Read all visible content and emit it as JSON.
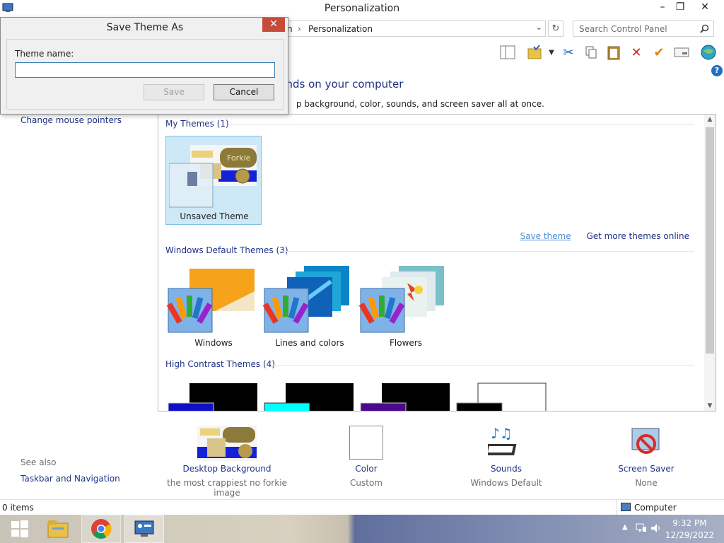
{
  "window": {
    "title": "Personalization",
    "minimize": "–",
    "maximize": "❐",
    "close": "✕"
  },
  "address": {
    "crumb_partial": "n",
    "crumb_sep": "›",
    "crumb_current": "Personalization",
    "search_placeholder": "Search Control Panel"
  },
  "main": {
    "heading": "unds on your computer",
    "subheading": "p background, color, sounds, and screen saver all at once."
  },
  "sidebar": {
    "link": "Change mouse pointers",
    "see_also": "See also",
    "taskbar_link": "Taskbar and Navigation"
  },
  "themes": {
    "my_themes_label": "My Themes (1)",
    "unsaved_label": "Unsaved Theme",
    "unsaved_preview_text": "Forkie",
    "save_theme": "Save theme",
    "more_themes": "Get more themes online",
    "default_label": "Windows Default Themes (3)",
    "default_items": [
      "Windows",
      "Lines and colors",
      "Flowers"
    ],
    "high_contrast_label": "High Contrast Themes (4)"
  },
  "bottom": {
    "background_title": "Desktop Background",
    "background_sub": "the most crappiest no forkie image",
    "color_title": "Color",
    "color_sub": "Custom",
    "sounds_title": "Sounds",
    "sounds_sub": "Windows Default",
    "saver_title": "Screen Saver",
    "saver_sub": "None"
  },
  "status": {
    "items": "0 items",
    "location": "Computer"
  },
  "clock": {
    "time": "9:32 PM",
    "date": "12/29/2022"
  },
  "dialog": {
    "title": "Save Theme As",
    "close": "✕",
    "label": "Theme name:",
    "input_value": "",
    "save": "Save",
    "cancel": "Cancel"
  },
  "colors": {
    "link": "#1e3287",
    "selection": "#cde8f7",
    "dialog_close": "#c74b3a"
  }
}
